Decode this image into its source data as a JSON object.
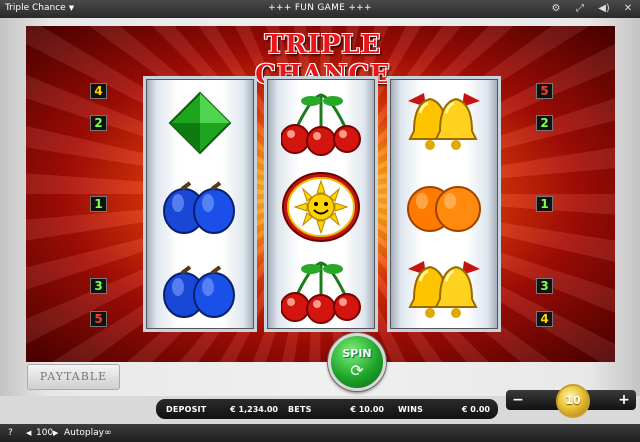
{
  "topbar": {
    "game_title": "Triple Chance",
    "mode": "+++ FUN GAME +++",
    "icons": [
      "gear-icon",
      "fullscreen-icon",
      "sound-icon",
      "close-icon"
    ]
  },
  "logo": "TRIPLE CHANCE",
  "paylines_left": [
    {
      "value": "4",
      "color": "#ffd400"
    },
    {
      "value": "2",
      "color": "#7cff4a"
    },
    {
      "value": "1",
      "color": "#7cff4a"
    },
    {
      "value": "3",
      "color": "#7cff4a"
    },
    {
      "value": "5",
      "color": "#ff3b30"
    }
  ],
  "paylines_right": [
    {
      "value": "5",
      "color": "#ff3b30"
    },
    {
      "value": "2",
      "color": "#7cff4a"
    },
    {
      "value": "1",
      "color": "#7cff4a"
    },
    {
      "value": "3",
      "color": "#7cff4a"
    },
    {
      "value": "4",
      "color": "#ffd400"
    }
  ],
  "reels": [
    [
      "diamond",
      "plums",
      "plums"
    ],
    [
      "cherries",
      "sun",
      "cherries"
    ],
    [
      "bells",
      "oranges",
      "bells"
    ]
  ],
  "paytable_label": "PAYTABLE",
  "spin_label": "SPIN",
  "info": {
    "deposit_label": "DEPOSIT",
    "deposit_value": "€ 1,234.00",
    "bets_label": "BETS",
    "bets_value": "€ 10.00",
    "wins_label": "WINS",
    "wins_value": "€ 0.00"
  },
  "bet_control": {
    "minus": "−",
    "plus": "+",
    "coin_value": "10"
  },
  "status": {
    "help": "?",
    "prev": "◀",
    "autoplay_count": "100",
    "next": "▶",
    "autoplay_label": "Autoplay",
    "infinity": "∞"
  }
}
